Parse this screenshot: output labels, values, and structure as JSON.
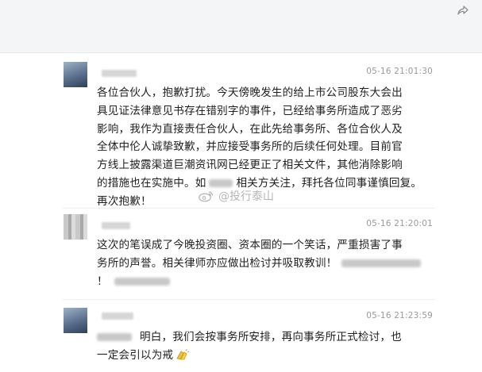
{
  "messages": [
    {
      "time": "05-16 21:01:30",
      "lines": [
        "各位合伙人，抱歉打扰。今天傍晚发生的给上市公司股东大会出",
        "具见证法律意见书存在错别字的事件，已经给事务所造成了恶劣",
        "影响，我作为直接责任合伙人，在此先给事务所、各位合伙人及",
        "全体中伦人诚挚致歉，并应接受事务所的后续任何处理。目前官",
        "方线上披露渠道巨潮资讯网已经更正了相关文件，其他消除影响",
        "的措施也在实施中。如",
        "相关方关注，拜托各位同事谨慎回复。",
        "再次抱歉！"
      ]
    },
    {
      "time": "05-16 21:20:01",
      "lines": [
        "这次的笔误成了今晚投资圈、资本圈的一个笑话，严重损害了事",
        "务所的声誉。相关律师亦应做出检讨并吸取教训！",
        "！"
      ]
    },
    {
      "time": "05-16 21:23:59",
      "lines": [
        "明白，我们会按事务所安排，再向事务所正式检讨，也",
        "一定会引以为戒"
      ]
    }
  ],
  "watermark": {
    "text": "@投行泰山"
  },
  "icons": {
    "share": "share-arrow-icon",
    "weibo": "weibo-icon",
    "clap": "clapping-hands-icon"
  },
  "colors": {
    "time": "#9a9a9a",
    "text": "#1f1f1f",
    "header_bg": "#f4f5f7"
  }
}
